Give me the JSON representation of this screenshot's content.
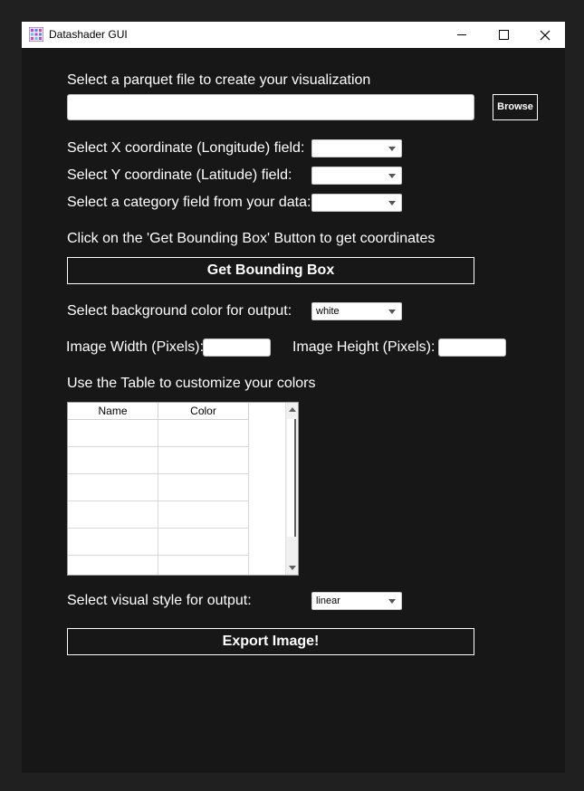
{
  "window": {
    "title": "Datashader GUI",
    "controls": {
      "minimize": "—",
      "maximize": "☐",
      "close": "✕"
    }
  },
  "file": {
    "label": "Select a parquet file to create your visualization",
    "path_value": "",
    "browse_label": "Browse"
  },
  "fields": {
    "x_label": "Select X coordinate (Longitude) field:",
    "x_value": "",
    "y_label": "Select Y coordinate (Latitude) field:",
    "y_value": "",
    "category_label": "Select a category field from your data:",
    "category_value": ""
  },
  "bbox": {
    "instruction": "Click on the 'Get Bounding Box' Button to get coordinates",
    "button_label": "Get Bounding Box"
  },
  "background": {
    "label": "Select background color for output:",
    "value": "white"
  },
  "size": {
    "width_label": "Image Width (Pixels):",
    "width_value": "",
    "height_label": "Image Height (Pixels):",
    "height_value": ""
  },
  "colors_table": {
    "label": "Use the Table to customize your colors",
    "columns": [
      "Name",
      "Color"
    ],
    "rows": [
      [
        "",
        ""
      ],
      [
        "",
        ""
      ],
      [
        "",
        ""
      ],
      [
        "",
        ""
      ],
      [
        "",
        ""
      ],
      [
        "",
        ""
      ]
    ]
  },
  "style": {
    "label": "Select visual style for output:",
    "value": "linear"
  },
  "export": {
    "button_label": "Export Image!"
  }
}
